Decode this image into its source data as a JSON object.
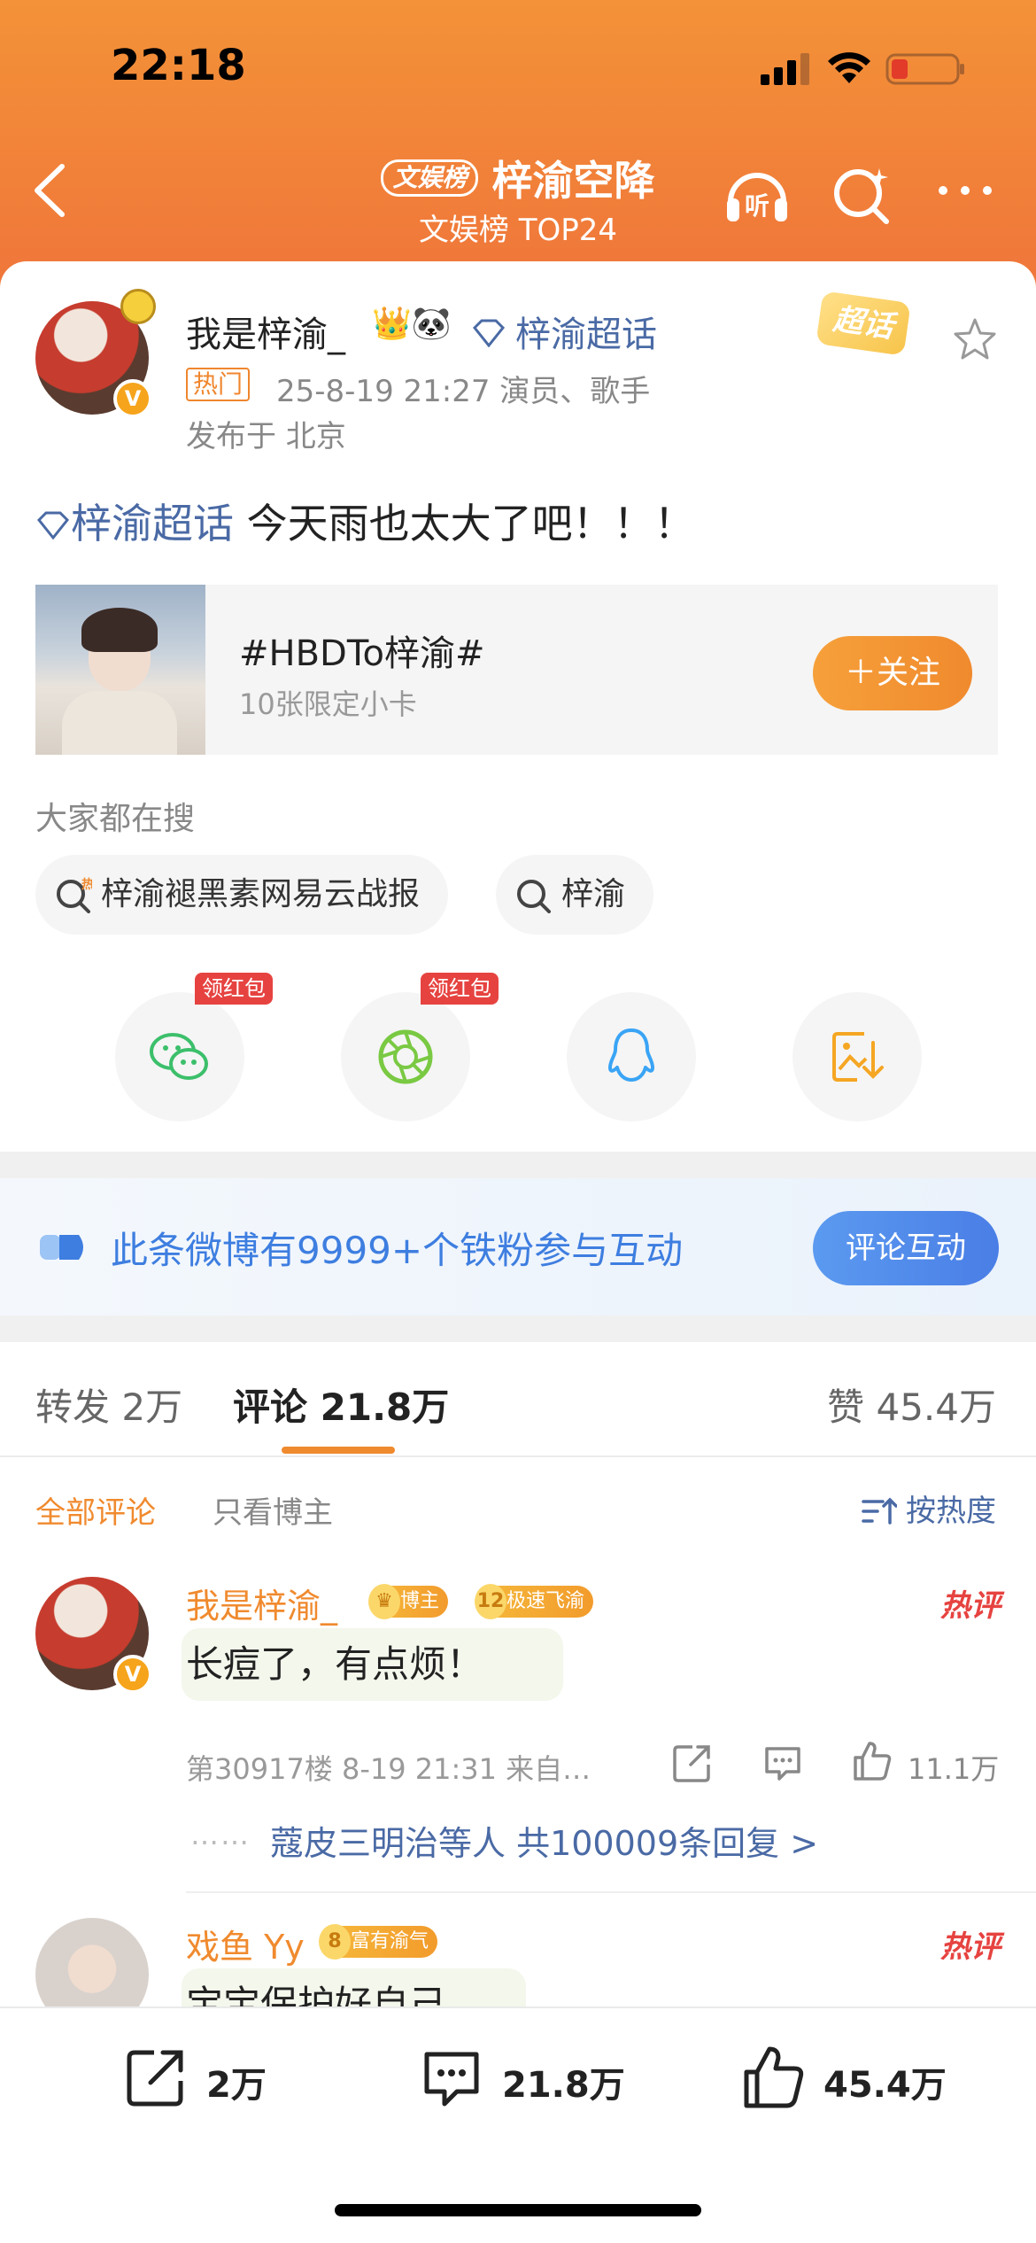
{
  "status_bar": {
    "time": "22:18"
  },
  "nav": {
    "badge": "文娱榜",
    "title": "梓渝空降",
    "subtitle": "文娱榜 TOP24",
    "listen_label": "听"
  },
  "post": {
    "author_name": "我是梓渝_",
    "author_emoji": "👑🐼",
    "supertopic_link": "梓渝超话",
    "super_tag": "超话",
    "hot_tag": "热门",
    "meta": "25-8-19 21:27  演员、歌手",
    "location": "发布于 北京",
    "topic_inline": "梓渝超话",
    "text": " 今天雨也太大了吧！！！"
  },
  "topic_card": {
    "title": "#HBDTo梓渝#",
    "subtitle": "10张限定小卡",
    "follow_label": "＋关注"
  },
  "search": {
    "label": "大家都在搜",
    "chips": [
      "梓渝褪黑素网易云战报",
      "梓渝"
    ]
  },
  "share": {
    "red_packet_label": "领红包",
    "icons": [
      "wechat-icon",
      "moments-icon",
      "qq-icon",
      "save-image-icon"
    ]
  },
  "fans_banner": {
    "text": "此条微博有9999+个铁粉参与互动",
    "button": "评论互动"
  },
  "tabs": {
    "repost": "转发  2万",
    "comment": "评论  21.8万",
    "like": "赞  45.4万"
  },
  "filters": {
    "all": "全部评论",
    "author_only": "只看博主",
    "sort": "按热度"
  },
  "comments": [
    {
      "name": "我是梓渝_",
      "badge1": "博主",
      "badge2_num": "12",
      "badge2": "极速飞渝",
      "hot": "热评",
      "text": "长痘了，有点烦！",
      "meta": "第30917楼  8-19 21:31  来自…",
      "likes": "11.1万",
      "dots": "……",
      "replies": "蔻皮三明治等人  共100009条回复 >"
    },
    {
      "name": "戏鱼 Yy",
      "badge_num": "8",
      "badge": "富有渝气",
      "hot": "热评",
      "text": "宝宝保护好自己"
    }
  ],
  "bottom_bar": {
    "repost": "2万",
    "comment": "21.8万",
    "like": "45.4万"
  },
  "colors": {
    "header_orange": "#f0753a",
    "accent_orange": "#f08a2e",
    "link_blue": "#4a6aa5",
    "hot_red": "#e64340",
    "fans_blue": "#3e7ee0"
  }
}
